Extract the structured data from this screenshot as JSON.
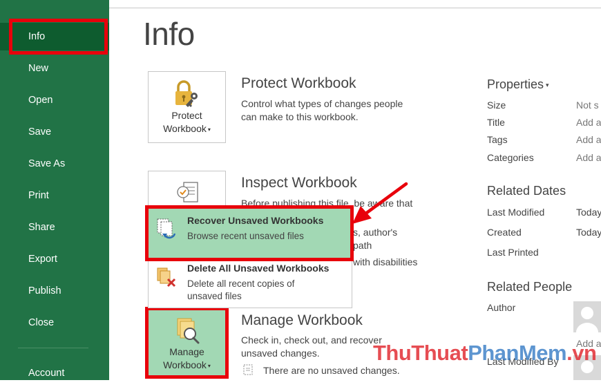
{
  "sidebar": {
    "items": [
      {
        "label": "Info"
      },
      {
        "label": "New"
      },
      {
        "label": "Open"
      },
      {
        "label": "Save"
      },
      {
        "label": "Save As"
      },
      {
        "label": "Print"
      },
      {
        "label": "Share"
      },
      {
        "label": "Export"
      },
      {
        "label": "Publish"
      },
      {
        "label": "Close"
      },
      {
        "label": "Account"
      }
    ]
  },
  "page_title": "Info",
  "protect": {
    "button_line1": "Protect",
    "button_line2": "Workbook",
    "title": "Protect Workbook",
    "desc_line1": "Control what types of changes people",
    "desc_line2": "can make to this workbook."
  },
  "inspect": {
    "title": "Inspect Workbook",
    "desc_line1": "Before publishing this file, be aware that",
    "frag_author": "s, author's",
    "frag_path": "path",
    "frag_disabilities": "with disabilities"
  },
  "dropdown": {
    "recover_title": "Recover Unsaved Workbooks",
    "recover_sub": "Browse recent unsaved files",
    "delete_title": "Delete All Unsaved Workbooks",
    "delete_sub_line1": "Delete all recent copies of",
    "delete_sub_line2": "unsaved files"
  },
  "manage": {
    "button_line1": "Manage",
    "button_line2": "Workbook",
    "title": "Manage Workbook",
    "desc_line1": "Check in, check out, and recover",
    "desc_line2": "unsaved changes.",
    "status": "There are no unsaved changes."
  },
  "properties": {
    "heading": "Properties",
    "size_label": "Size",
    "size_value": "Not s",
    "title_label": "Title",
    "title_value": "Add a",
    "tags_label": "Tags",
    "tags_value": "Add a",
    "categories_label": "Categories",
    "categories_value": "Add a",
    "related_dates": "Related Dates",
    "last_modified_label": "Last Modified",
    "last_modified_value": "Today",
    "created_label": "Created",
    "created_value": "Today",
    "last_printed_label": "Last Printed",
    "related_people": "Related People",
    "author_label": "Author",
    "add_author": "Add a",
    "last_modified_by_label": "Last Modified By"
  },
  "watermark": {
    "part1": "ThuThuat",
    "part2": "PhanMem",
    "part3": ".vn"
  },
  "colors": {
    "sidebar": "#217346",
    "highlight": "#a2d8b4",
    "annotation": "#e8000b"
  }
}
